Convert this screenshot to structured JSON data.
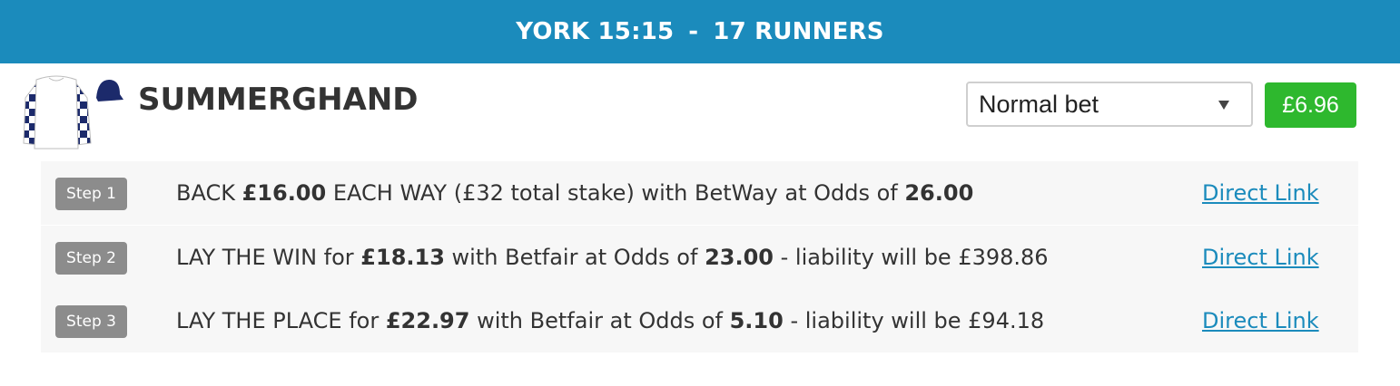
{
  "header": {
    "race": "YORK 15:15",
    "separator": "-",
    "runners": "17 RUNNERS"
  },
  "silks_icon": "jockey-silks-icon",
  "horse": {
    "name": "SUMMERGHAND"
  },
  "bet_type": {
    "selected": "Normal bet"
  },
  "price": "£6.96",
  "colors": {
    "header": "#1b8bbc",
    "price_badge": "#2eb82e",
    "step_badge": "#8c8c8c",
    "silks_navy": "#1c2a6b",
    "link": "#1b8bbc"
  },
  "steps": [
    {
      "badge": "Step 1",
      "t1": "BACK ",
      "b1": "£16.00",
      "t2": " EACH WAY (£32 total stake) with BetWay at Odds of ",
      "b2": "26.00",
      "t3": "",
      "link": "Direct Link"
    },
    {
      "badge": "Step 2",
      "t1": "LAY THE WIN for ",
      "b1": "£18.13",
      "t2": " with Betfair at Odds of ",
      "b2": "23.00",
      "t3": " - liability will be £398.86",
      "link": "Direct Link"
    },
    {
      "badge": "Step 3",
      "t1": "LAY THE PLACE for ",
      "b1": "£22.97",
      "t2": " with Betfair at Odds of ",
      "b2": "5.10",
      "t3": " - liability will be £94.18",
      "link": "Direct Link"
    }
  ]
}
